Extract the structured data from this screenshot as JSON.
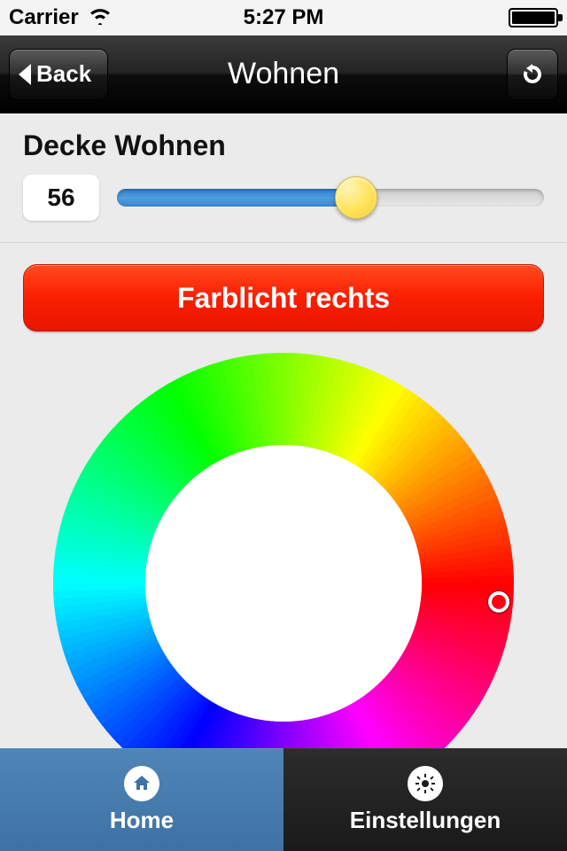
{
  "status_bar": {
    "carrier": "Carrier",
    "time": "5:27 PM"
  },
  "nav": {
    "back_label": "Back",
    "title": "Wohnen"
  },
  "dimmer": {
    "title": "Decke Wohnen",
    "value": "56",
    "percent": 56
  },
  "color_light": {
    "button_label": "Farblicht rechts",
    "button_color": "#fa1e00",
    "selected_hue_deg": 355
  },
  "tabs": {
    "home_label": "Home",
    "settings_label": "Einstellungen",
    "active": "home"
  }
}
